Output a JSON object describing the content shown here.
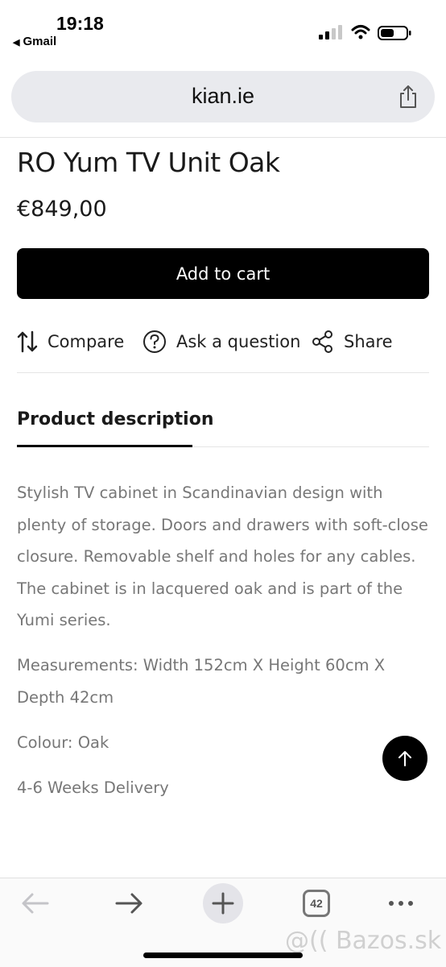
{
  "status": {
    "time": "19:18",
    "back_app": "Gmail"
  },
  "browser": {
    "url": "kian.ie",
    "tabs_count": "42"
  },
  "product": {
    "title": "RO Yum TV Unit Oak",
    "price": "€849,00",
    "add_to_cart": "Add to cart",
    "actions": {
      "compare": "Compare",
      "ask": "Ask a question",
      "share": "Share"
    },
    "tab_label": "Product description",
    "description": [
      "Stylish TV cabinet in Scandinavian design with plenty of storage. Doors and drawers with soft-close closure. Removable shelf and holes for any cables. The cabinet is in lacquered oak and is part of the Yumi series.",
      "Measurements: Width 152cm X Height 60cm X Depth 42cm",
      "Colour: Oak",
      "4-6 Weeks Delivery"
    ]
  },
  "watermark": "@(( Bazos.sk",
  "colors": {
    "button_bg": "#000000",
    "text_muted": "#777777",
    "url_bar_bg": "#e9eaee"
  }
}
